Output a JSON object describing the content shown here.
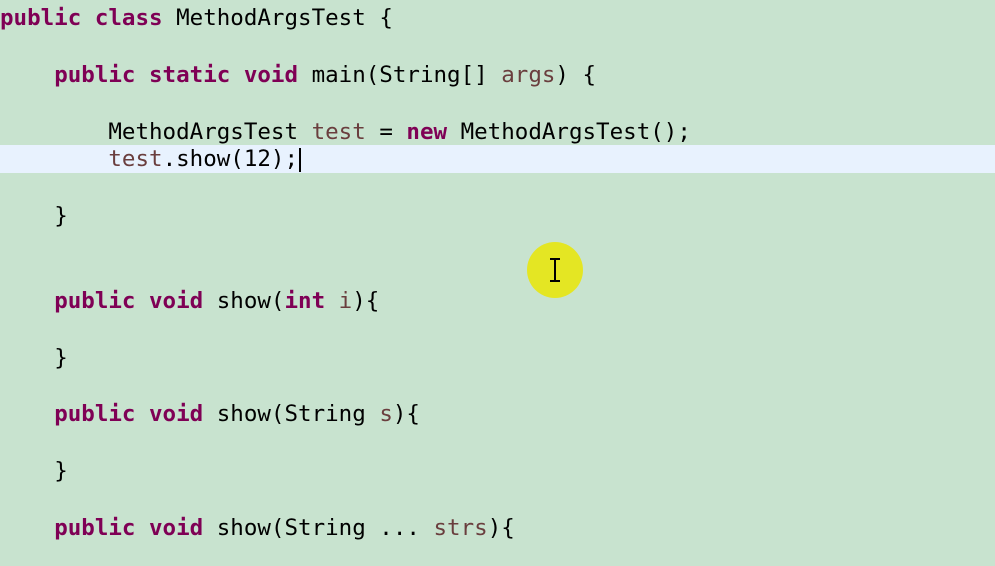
{
  "code": {
    "line1": {
      "kw1": "public",
      "kw2": "class",
      "name": "MethodArgsTest",
      "brace": "{"
    },
    "line2": {
      "kw1": "public",
      "kw2": "static",
      "kw3": "void",
      "sig": "main(String[]",
      "param": "args",
      "rest": ") {"
    },
    "line3": {
      "type": "MethodArgsTest",
      "var": "test",
      "eq": "=",
      "kw": "new",
      "rest": "MethodArgsTest();"
    },
    "line4": {
      "obj": "test",
      "call": ".show(12);"
    },
    "line5": {
      "brace": "}"
    },
    "line6": {
      "kw1": "public",
      "kw2": "void",
      "name": "show(",
      "kw3": "int",
      "param": "i",
      "rest": "){"
    },
    "line7": {
      "brace": "}"
    },
    "line8": {
      "kw1": "public",
      "kw2": "void",
      "name": "show(String",
      "param": "s",
      "rest": "){"
    },
    "line9": {
      "brace": "}"
    },
    "line10": {
      "kw1": "public",
      "kw2": "void",
      "name": "show(String ...",
      "param": "strs",
      "rest": "){"
    }
  },
  "colors": {
    "background": "#c8e3cf",
    "current_line": "#e8f2fe",
    "keyword": "#7f0055",
    "variable": "#6a3e3e",
    "cursor_highlight": "#e6e619"
  },
  "icons": {
    "mouse_cursor": "text-ibeam-icon"
  }
}
